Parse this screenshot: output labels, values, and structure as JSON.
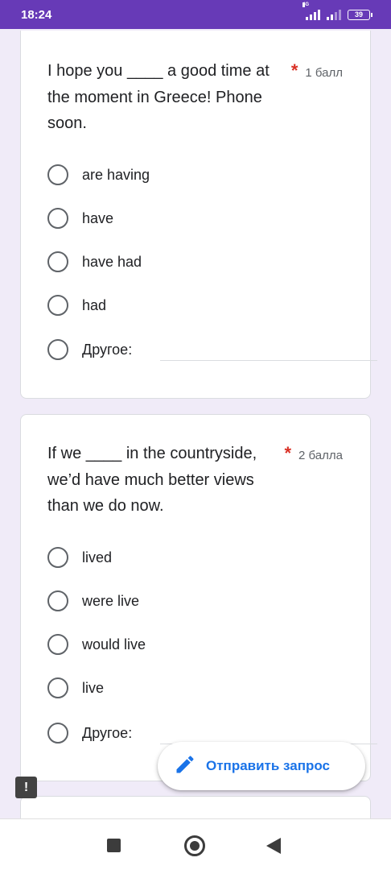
{
  "status_bar": {
    "time": "18:24",
    "network": "4G",
    "battery": "39"
  },
  "questions": [
    {
      "text": "I hope you ____ a good time at the moment in Greece! Phone soon.",
      "required_mark": "*",
      "points": "1 балл",
      "options": [
        "are having",
        "have",
        "have had",
        "had",
        "Другое:"
      ]
    },
    {
      "text": "If we ____ in the countryside, we’d have much better views than we do now.",
      "required_mark": "*",
      "points": "2 балла",
      "options": [
        "lived",
        "were live",
        "would live",
        "live",
        "Другое:"
      ]
    }
  ],
  "submit_button": {
    "label": "Отправить запрос",
    "icon": "pencil-icon"
  },
  "feedback_icon": "!",
  "colors": {
    "accent": "#673ab7",
    "link": "#1a73e8",
    "required": "#d93025"
  }
}
